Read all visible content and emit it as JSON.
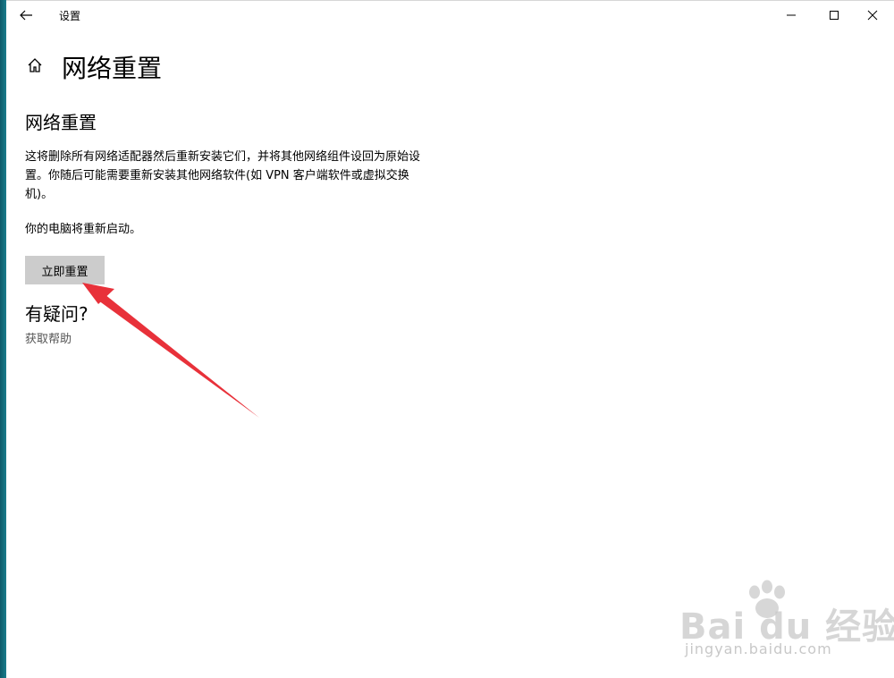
{
  "window": {
    "title": "设置",
    "icons": {
      "back": "back-arrow-icon",
      "minimize": "minimize-icon",
      "maximize": "maximize-icon",
      "close": "close-icon"
    }
  },
  "page": {
    "home_icon": "home-icon",
    "title": "网络重置"
  },
  "content": {
    "section_heading": "网络重置",
    "description": "这将删除所有网络适配器然后重新安装它们，并将其他网络组件设回为原始设置。你随后可能需要重新安装其他网络软件(如 VPN 客户端软件或虚拟交换机)。",
    "restart_note": "你的电脑将重新启动。",
    "reset_button": "立即重置",
    "question_heading": "有疑问?",
    "help_link": "获取帮助"
  },
  "annotation": {
    "arrow_color": "#e8313a"
  },
  "watermark": {
    "logo_text": "Bai du 经验",
    "url": "jingyan.baidu.com"
  }
}
